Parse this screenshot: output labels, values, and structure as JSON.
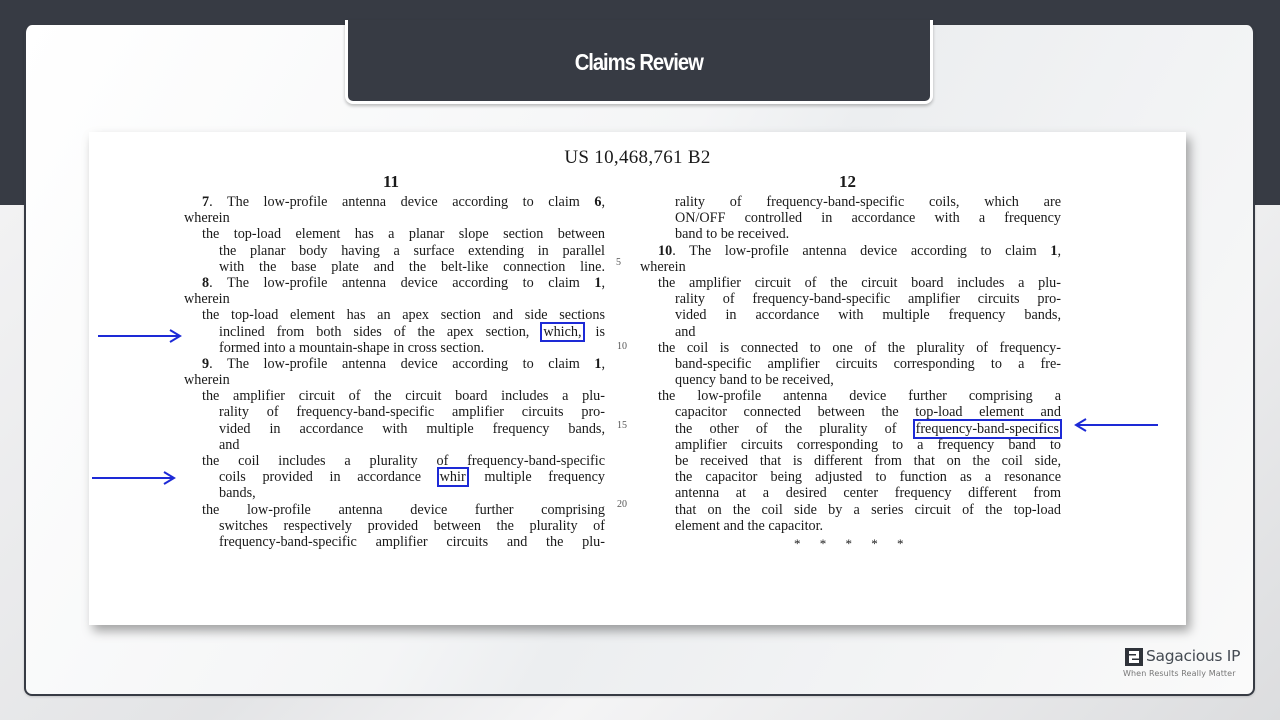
{
  "slide": {
    "title": "Claims Review"
  },
  "patent": {
    "number": "US 10,468,761 B2",
    "left_column_number": "11",
    "right_column_number": "12",
    "left_lines": [
      {
        "indent": "c1",
        "parts": [
          {
            "b": "7"
          },
          {
            "t": ". The low-profile antenna device according to claim "
          },
          {
            "b": "6"
          },
          {
            "t": ","
          }
        ]
      },
      {
        "indent": "i0",
        "last": true,
        "parts": [
          {
            "t": "wherein"
          }
        ]
      },
      {
        "indent": "i1",
        "parts": [
          {
            "t": "the top-load element has a planar slope section between"
          }
        ]
      },
      {
        "indent": "i2",
        "parts": [
          {
            "t": "the planar body having a surface extending in parallel"
          }
        ]
      },
      {
        "indent": "i2",
        "parts": [
          {
            "t": "with the base plate and the belt-like connection line."
          }
        ]
      },
      {
        "indent": "c1",
        "parts": [
          {
            "b": "8"
          },
          {
            "t": ". The low-profile antenna device according to claim "
          },
          {
            "b": "1"
          },
          {
            "t": ","
          }
        ]
      },
      {
        "indent": "i0",
        "last": true,
        "parts": [
          {
            "t": "wherein"
          }
        ]
      },
      {
        "indent": "i1",
        "parts": [
          {
            "t": "the top-load element has an apex section and side sections"
          }
        ]
      },
      {
        "indent": "i2",
        "parts": [
          {
            "t": "inclined from both sides of the apex section, "
          },
          {
            "hl": "which,"
          },
          {
            "t": " is"
          }
        ]
      },
      {
        "indent": "i2",
        "last": true,
        "parts": [
          {
            "t": "formed into a mountain-shape in cross section."
          }
        ]
      },
      {
        "indent": "c1",
        "parts": [
          {
            "b": "9"
          },
          {
            "t": ". The low-profile antenna device according to claim "
          },
          {
            "b": "1"
          },
          {
            "t": ","
          }
        ]
      },
      {
        "indent": "i0",
        "last": true,
        "parts": [
          {
            "t": "wherein"
          }
        ]
      },
      {
        "indent": "i1",
        "parts": [
          {
            "t": "the amplifier circuit of the circuit board includes a plu-"
          }
        ]
      },
      {
        "indent": "i2",
        "parts": [
          {
            "t": "rality of frequency-band-specific amplifier circuits pro-"
          }
        ]
      },
      {
        "indent": "i2",
        "parts": [
          {
            "t": "vided in accordance with multiple frequency bands,"
          }
        ]
      },
      {
        "indent": "i2",
        "last": true,
        "parts": [
          {
            "t": "and"
          }
        ]
      },
      {
        "indent": "i1",
        "parts": [
          {
            "t": "the coil includes a plurality of frequency-band-specific"
          }
        ]
      },
      {
        "indent": "i2",
        "parts": [
          {
            "t": "coils provided in accordance "
          },
          {
            "hl": "whir"
          },
          {
            "t": " multiple frequency"
          }
        ]
      },
      {
        "indent": "i2",
        "last": true,
        "parts": [
          {
            "t": "bands,"
          }
        ]
      },
      {
        "indent": "i1",
        "parts": [
          {
            "t": "the low-profile antenna device further comprising"
          }
        ]
      },
      {
        "indent": "i2",
        "parts": [
          {
            "t": "switches respectively provided between the plurality of"
          }
        ]
      },
      {
        "indent": "i2",
        "parts": [
          {
            "t": "frequency-band-specific amplifier circuits and the plu-"
          }
        ]
      }
    ],
    "right_lines": [
      {
        "indent": "i2",
        "parts": [
          {
            "t": "rality of frequency-band-specific coils, which are"
          }
        ]
      },
      {
        "indent": "i2",
        "parts": [
          {
            "t": "ON/OFF controlled in accordance with a frequency"
          }
        ]
      },
      {
        "indent": "i2",
        "last": true,
        "parts": [
          {
            "t": "band to be received."
          }
        ]
      },
      {
        "indent": "c1",
        "parts": [
          {
            "b": "10"
          },
          {
            "t": ". The low-profile antenna device according to claim "
          },
          {
            "b": "1"
          },
          {
            "t": ","
          }
        ]
      },
      {
        "indent": "i0",
        "last": true,
        "parts": [
          {
            "t": "wherein"
          }
        ]
      },
      {
        "indent": "i1",
        "parts": [
          {
            "t": "the amplifier circuit of the circuit board includes a plu-"
          }
        ]
      },
      {
        "indent": "i2",
        "parts": [
          {
            "t": "rality of frequency-band-specific amplifier circuits pro-"
          }
        ]
      },
      {
        "indent": "i2",
        "parts": [
          {
            "t": "vided in accordance with multiple frequency bands,"
          }
        ]
      },
      {
        "indent": "i2",
        "last": true,
        "parts": [
          {
            "t": "and"
          }
        ]
      },
      {
        "indent": "i1",
        "parts": [
          {
            "t": "the coil is connected to one of the plurality of frequency-"
          }
        ]
      },
      {
        "indent": "i2",
        "parts": [
          {
            "t": "band-specific amplifier circuits corresponding to a fre-"
          }
        ]
      },
      {
        "indent": "i2",
        "last": true,
        "parts": [
          {
            "t": "quency band to be received,"
          }
        ]
      },
      {
        "indent": "i1",
        "parts": [
          {
            "t": "the low-profile antenna device further comprising a"
          }
        ]
      },
      {
        "indent": "i2",
        "parts": [
          {
            "t": "capacitor connected between the top-load element and"
          }
        ]
      },
      {
        "indent": "i2",
        "parts": [
          {
            "t": "the other of the plurality of "
          },
          {
            "hl": "frequency-band-specifics"
          }
        ]
      },
      {
        "indent": "i2",
        "parts": [
          {
            "t": "amplifier circuits corresponding to a frequency band to"
          }
        ]
      },
      {
        "indent": "i2",
        "parts": [
          {
            "t": "be received that is different from that on the coil side,"
          }
        ]
      },
      {
        "indent": "i2",
        "parts": [
          {
            "t": "the capacitor being adjusted to function as a resonance"
          }
        ]
      },
      {
        "indent": "i2",
        "parts": [
          {
            "t": "antenna at a desired center frequency different from"
          }
        ]
      },
      {
        "indent": "i2",
        "parts": [
          {
            "t": "that on the coil side by a series circuit of the top-load"
          }
        ]
      },
      {
        "indent": "i2",
        "last": true,
        "parts": [
          {
            "t": "element and the capacitor."
          }
        ]
      }
    ],
    "line_numbers": [
      "5",
      "10",
      "15",
      "20"
    ],
    "end_marker": "* * * * *"
  },
  "annotations": {
    "arrow_color": "#1d2ad6",
    "highlight_color": "#1d2ad6",
    "arrows": [
      {
        "target": "which,",
        "direction": "right"
      },
      {
        "target": "whir",
        "direction": "right"
      },
      {
        "target": "frequency-band-specifics",
        "direction": "left"
      }
    ]
  },
  "brand": {
    "name": "Sagacious IP",
    "tagline": "When Results Really Matter",
    "logo_icon": "sagacious-s-logo-icon"
  },
  "colors": {
    "header_dark": "#373b44",
    "accent_blue": "#1d2ad6"
  }
}
